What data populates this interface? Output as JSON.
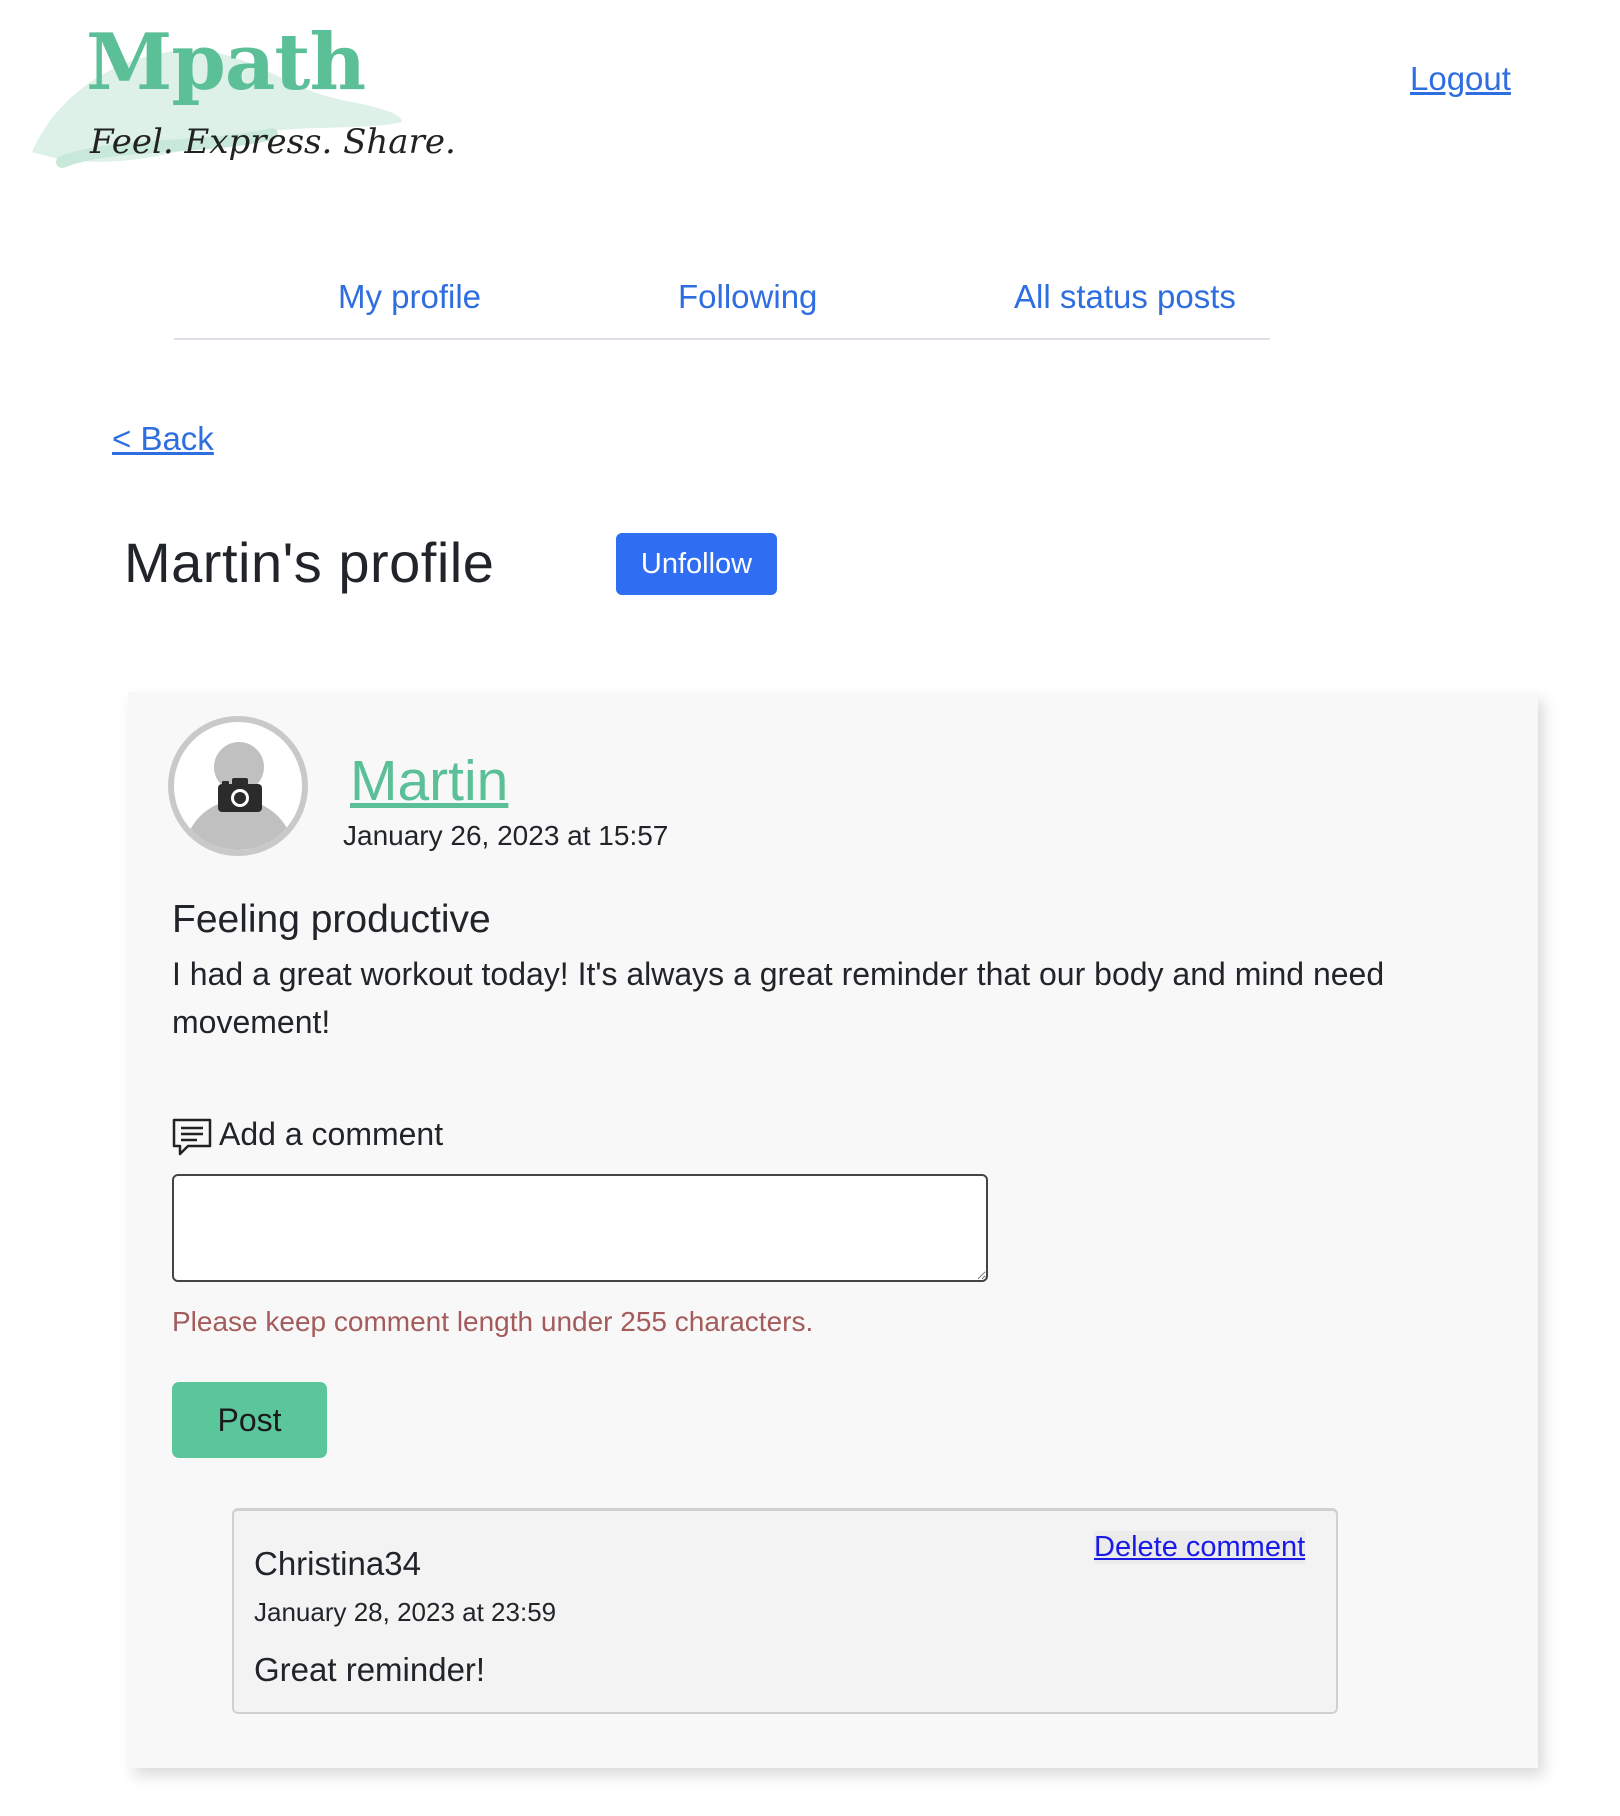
{
  "brand": {
    "name": "Mpath",
    "tagline": "Feel. Express. Share.",
    "accent_color": "#5bbf97"
  },
  "header": {
    "logout_label": "Logout"
  },
  "nav": {
    "items": [
      {
        "label": "My profile"
      },
      {
        "label": "Following"
      },
      {
        "label": "All status posts"
      }
    ]
  },
  "back_label": "< Back",
  "profile": {
    "title": "Martin's profile",
    "unfollow_label": "Unfollow"
  },
  "post": {
    "author": "Martin",
    "date": "January 26, 2023 at 15:57",
    "title": "Feeling productive",
    "body": "I had a great workout today! It's always a great reminder that our body and mind need movement!",
    "avatar_icon": "camera-icon"
  },
  "comment_form": {
    "label": "Add a comment",
    "icon": "comment-icon",
    "value": "",
    "help_text": "Please keep comment length under 255 characters.",
    "submit_label": "Post"
  },
  "comments": [
    {
      "author": "Christina34",
      "date": "January 28, 2023 at 23:59",
      "text": "Great reminder!",
      "delete_label": "Delete comment"
    }
  ]
}
